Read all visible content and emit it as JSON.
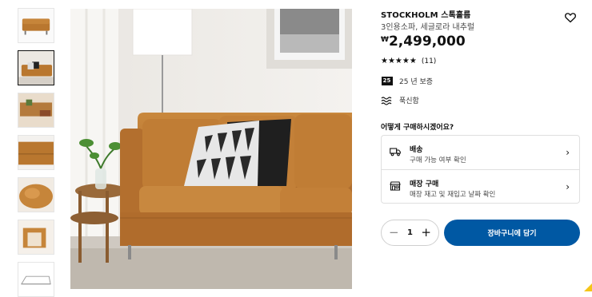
{
  "product": {
    "title": "STOCKHOLM 스톡홀름",
    "subtitle": "3인용소파, 세글로라 내추럴",
    "currency_symbol": "₩",
    "price": "2,499,000",
    "rating_stars": "★★★★★",
    "rating_value": 4.5,
    "review_count": "(11)",
    "wishlist_icon": "heart-icon"
  },
  "features": [
    {
      "icon": "25-badge",
      "badge_text": "25",
      "label": "25 년 보증"
    },
    {
      "icon": "wave-icon",
      "label": "푹신함"
    }
  ],
  "purchase": {
    "question": "어떻게 구매하시겠어요?",
    "options": [
      {
        "icon": "truck-icon",
        "title": "배송",
        "subtitle": "구매 가능 여부 확인"
      },
      {
        "icon": "store-icon",
        "title": "매장 구매",
        "subtitle": "매장 재고 및 재입고 날짜 확인"
      }
    ],
    "quantity": "1",
    "minus": "−",
    "plus": "+",
    "add_to_cart": "장바구니에 담기"
  },
  "gallery": {
    "thumb_count": 7,
    "active_index": 1
  },
  "colors": {
    "accent_blue": "#0058a3",
    "sofa_leather": "#b9772f",
    "text": "#111111"
  }
}
